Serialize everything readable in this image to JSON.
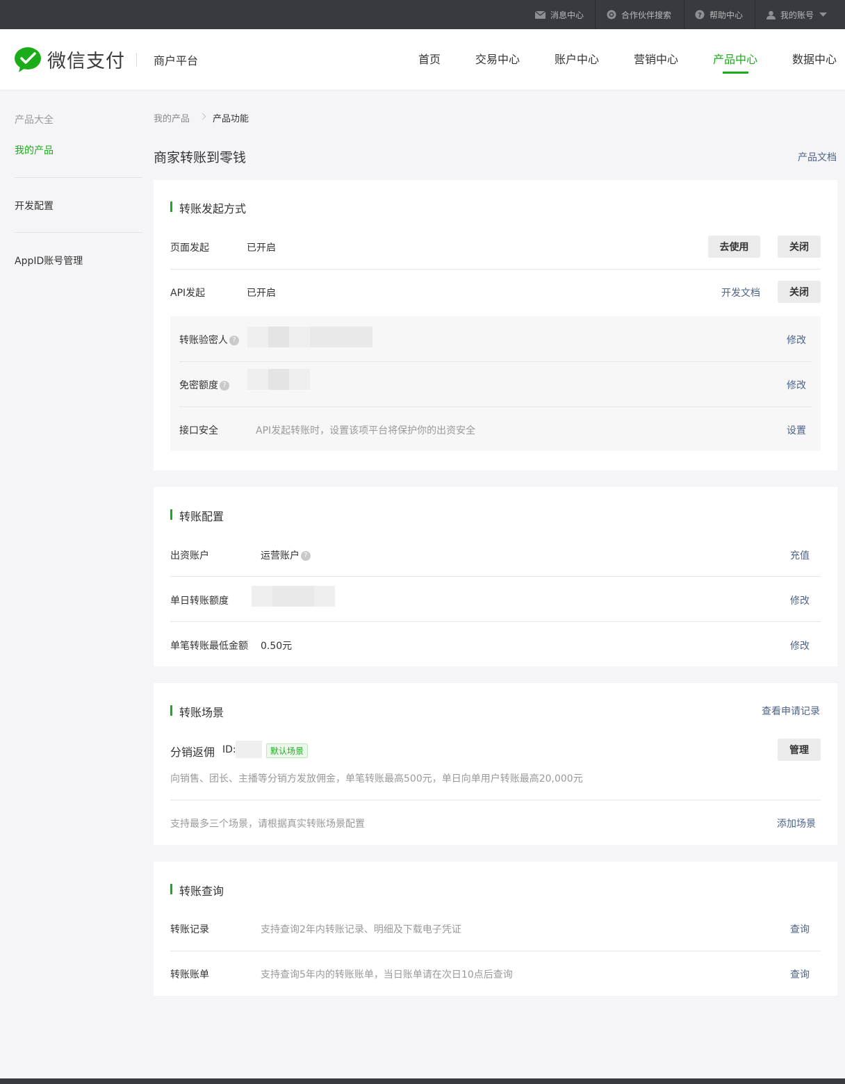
{
  "topbar": {
    "messages": "消息中心",
    "partner_search": "合作伙伴搜索",
    "help": "帮助中心",
    "account": "我的账号"
  },
  "header": {
    "brand": "微信支付",
    "sub_brand": "商户平台",
    "nav": [
      "首页",
      "交易中心",
      "账户中心",
      "营销中心",
      "产品中心",
      "数据中心"
    ],
    "active_nav": "产品中心"
  },
  "sidebar": {
    "title": "产品大全",
    "items": [
      "我的产品",
      "开发配置",
      "AppID账号管理"
    ]
  },
  "breadcrumb": {
    "parent": "我的产品",
    "current": "产品功能"
  },
  "page": {
    "title": "商家转账到零钱",
    "doc_link": "产品文档"
  },
  "initiation": {
    "title": "转账发起方式",
    "page": {
      "label": "页面发起",
      "status": "已开启",
      "use_btn": "去使用",
      "close_btn": "关闭"
    },
    "api": {
      "label": "API发起",
      "status": "已开启",
      "doc_link": "开发文档",
      "close_btn": "关闭"
    },
    "verifier": {
      "label": "转账验密人",
      "action": "修改"
    },
    "free_limit": {
      "label": "免密额度",
      "action": "修改"
    },
    "security": {
      "label": "接口安全",
      "desc": "API发起转账时，设置该项平台将保护你的出资安全",
      "action": "设置"
    }
  },
  "config": {
    "title": "转账配置",
    "fund_account": {
      "label": "出资账户",
      "value": "运营账户",
      "action": "充值"
    },
    "daily_limit": {
      "label": "单日转账额度",
      "action": "修改"
    },
    "min_amount": {
      "label": "单笔转账最低金额",
      "value": "0.50元",
      "action": "修改"
    }
  },
  "scene": {
    "title": "转账场景",
    "history_link": "查看申请记录",
    "name": "分销返佣",
    "id_label": "ID:",
    "default_tag": "默认场景",
    "manage_btn": "管理",
    "desc": "向销售、团长、主播等分销方发放佣金，单笔转账最高500元，单日向单用户转账最高20,000元",
    "footer_note": "支持最多三个场景，请根据真实转账场景配置",
    "add_link": "添加场景"
  },
  "query": {
    "title": "转账查询",
    "records": {
      "label": "转账记录",
      "desc": "支持查询2年内转账记录、明细及下载电子凭证",
      "action": "查询"
    },
    "bills": {
      "label": "转账账单",
      "desc": "支持查询5年内的转账账单，当日账单请在次日10点后查询",
      "action": "查询"
    }
  },
  "colors": {
    "accent": "#1aad19",
    "link": "#4d6388",
    "topbar": "#373a3f"
  }
}
